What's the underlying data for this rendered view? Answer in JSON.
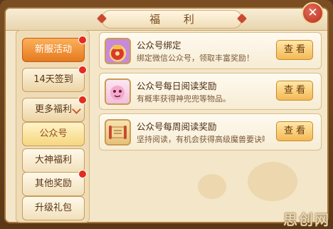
{
  "title": "福 利",
  "close_icon": "✕",
  "sidebar": {
    "items": [
      {
        "label": "新服活动",
        "state": "active",
        "badge": true
      },
      {
        "label": "14天签到",
        "state": "normal",
        "badge": true
      },
      {
        "label": "更多福利",
        "state": "expanded",
        "badge": true
      },
      {
        "label": "公众号",
        "state": "selected",
        "badge": false
      },
      {
        "label": "大神福利",
        "state": "sub",
        "badge": false
      },
      {
        "label": "其他奖励",
        "state": "sub",
        "badge": true
      },
      {
        "label": "升级礼包",
        "state": "sub",
        "badge": false
      }
    ]
  },
  "rewards": [
    {
      "title": "公众号绑定",
      "desc": "绑定微信公众号，领取丰富奖励！",
      "button": "查看",
      "icon": "gift-bag-icon"
    },
    {
      "title": "公众号每日阅读奖励",
      "desc": "有概率获得神兜兜等物品。",
      "button": "查看",
      "icon": "pet-icon"
    },
    {
      "title": "公众号每周阅读奖励",
      "desc": "坚持阅读，有机会获得高级魔兽要诀哦~",
      "button": "查看",
      "icon": "scroll-icon"
    }
  ],
  "watermark": "思创网",
  "colors": {
    "accent_orange": "#e57a20",
    "badge_red": "#e32c1d",
    "close_red": "#b5321f"
  }
}
